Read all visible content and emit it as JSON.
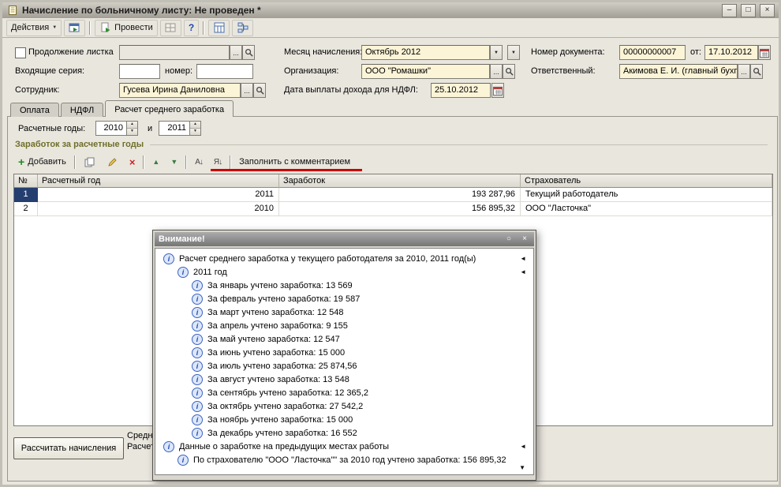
{
  "window": {
    "title": "Начисление по больничному листу: Не проведен *"
  },
  "icons": {
    "minimize": "–",
    "maximize": "□",
    "close": "×",
    "dropdown": "▼",
    "ellipsis": "...",
    "help": "?",
    "add_plus": "+",
    "delete_x": "×",
    "move_up": "▲",
    "move_down": "▼",
    "sort_asc": "А↓",
    "sort_desc": "Я↓",
    "info": "i",
    "marker": "◄",
    "pin": "○",
    "spin_up": "▲",
    "spin_down": "▼",
    "scroll_down": "▼"
  },
  "toolbar": {
    "actions_label": "Действия",
    "post_label": "Провести"
  },
  "form": {
    "continuation_label": "Продолжение листка",
    "month_label": "Месяц начисления:",
    "month_value": "Октябрь 2012",
    "doc_number_label": "Номер документа:",
    "doc_number": "00000000007",
    "from_label": "от:",
    "doc_date": "17.10.2012",
    "series_label": "Входящие серия:",
    "number_label": "номер:",
    "org_label": "Организация:",
    "org_value": "ООО \"Ромашки\"",
    "responsible_label": "Ответственный:",
    "responsible_value": "Акимова Е. И. (главный бухгал",
    "employee_label": "Сотрудник:",
    "employee_value": "Гусева Ирина Даниловна",
    "ndfl_label": "Дата выплаты дохода для НДФЛ:",
    "ndfl_date": "25.10.2012"
  },
  "tabs": [
    {
      "label": "Оплата",
      "active": false
    },
    {
      "label": "НДФЛ",
      "active": false
    },
    {
      "label": "Расчет среднего заработка",
      "active": true
    }
  ],
  "calc_years": {
    "label": "Расчетные годы:",
    "year1": "2010",
    "conj": "и",
    "year2": "2011"
  },
  "earnings": {
    "section_title": "Заработок за расчетные годы",
    "add_label": "Добавить",
    "fill_label": "Заполнить с комментарием",
    "columns": [
      "№",
      "Расчетный год",
      "Заработок",
      "Страхователь"
    ],
    "rows": [
      {
        "num": "1",
        "year": "2011",
        "amount": "193 287,96",
        "insurer": "Текущий работодатель",
        "selected": true
      },
      {
        "num": "2",
        "year": "2010",
        "amount": "156 895,32",
        "insurer": "ООО \"Ласточка\"",
        "selected": false
      }
    ]
  },
  "footer": {
    "calc_button": "Рассчитать начисления",
    "clipped_line1": "Средн",
    "clipped_line2": "Расчет"
  },
  "popup": {
    "title": "Внимание!",
    "messages": [
      {
        "indent": 0,
        "text": "Расчет среднего заработка у текущего работодателя за 2010, 2011 год(ы)",
        "marker": true
      },
      {
        "indent": 1,
        "text": "2011 год",
        "marker": true
      },
      {
        "indent": 2,
        "text": "За январь учтено заработка: 13 569"
      },
      {
        "indent": 2,
        "text": "За февраль учтено заработка: 19 587"
      },
      {
        "indent": 2,
        "text": "За март учтено заработка: 12 548"
      },
      {
        "indent": 2,
        "text": "За апрель учтено заработка: 9 155"
      },
      {
        "indent": 2,
        "text": "За май учтено заработка: 12 547"
      },
      {
        "indent": 2,
        "text": "За июнь учтено заработка: 15 000"
      },
      {
        "indent": 2,
        "text": "За июль учтено заработка: 25 874,56"
      },
      {
        "indent": 2,
        "text": "За август учтено заработка: 13 548"
      },
      {
        "indent": 2,
        "text": "За сентябрь учтено заработка: 12 365,2"
      },
      {
        "indent": 2,
        "text": "За октябрь учтено заработка: 27 542,2"
      },
      {
        "indent": 2,
        "text": "За ноябрь учтено заработка: 15 000"
      },
      {
        "indent": 2,
        "text": "За декабрь учтено заработка: 16 552"
      },
      {
        "indent": 0,
        "text": "Данные о заработке на предыдущих местах работы",
        "marker": true
      },
      {
        "indent": 1,
        "text": "По страхователю \"ООО \"Ласточка\"\" за 2010 год учтено заработка: 156 895,32"
      }
    ]
  },
  "annotation": {
    "color": "#cc0000"
  }
}
